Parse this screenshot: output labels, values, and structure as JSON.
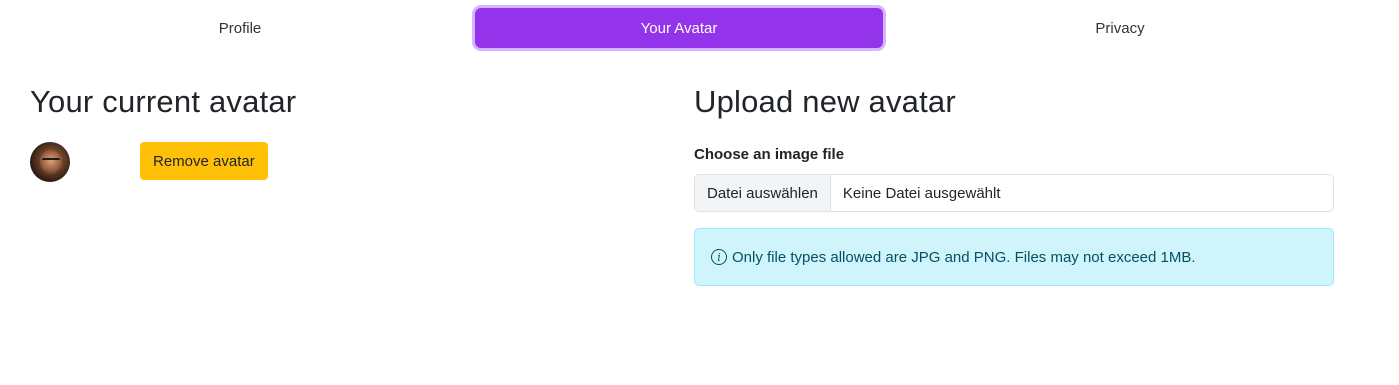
{
  "tabs": [
    {
      "label": "Profile"
    },
    {
      "label": "Your Avatar",
      "active": true
    },
    {
      "label": "Privacy"
    }
  ],
  "current": {
    "heading": "Your current avatar",
    "remove_label": "Remove avatar"
  },
  "upload": {
    "heading": "Upload new avatar",
    "field_label": "Choose an image file",
    "file_button": "Datei auswählen",
    "file_status": "Keine Datei ausgewählt",
    "info_icon": "info-circle-icon",
    "info_text": "Only file types allowed are JPG and PNG. Files may not exceed 1MB."
  },
  "colors": {
    "active_tab": "#9333ea",
    "warning_button": "#ffc107",
    "info_alert_bg": "#cff4fc"
  }
}
